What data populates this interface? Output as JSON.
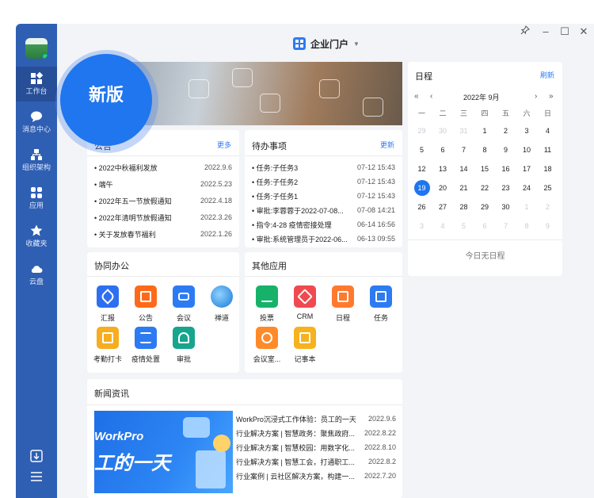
{
  "window": {
    "title": "企业门户",
    "controls": [
      "pin",
      "minimize",
      "maximize",
      "close"
    ]
  },
  "sidebar": {
    "items": [
      {
        "label": "工作台",
        "icon": "workbench-icon",
        "active": true
      },
      {
        "label": "消息中心",
        "icon": "message-icon"
      },
      {
        "label": "组织架构",
        "icon": "org-icon"
      },
      {
        "label": "应用",
        "icon": "apps-icon"
      },
      {
        "label": "收藏夹",
        "icon": "star-icon"
      },
      {
        "label": "云盘",
        "icon": "cloud-icon"
      }
    ],
    "bottom": [
      "download-icon",
      "menu-icon"
    ]
  },
  "badge": {
    "label": "新版"
  },
  "announcements": {
    "title": "公告",
    "more": "更多",
    "items": [
      {
        "title": "2022中秋福利发放",
        "date": "2022.9.6"
      },
      {
        "title": "端午",
        "date": "2022.5.23"
      },
      {
        "title": "2022年五一节放假通知",
        "date": "2022.4.18"
      },
      {
        "title": "2022年清明节放假通知",
        "date": "2022.3.26"
      },
      {
        "title": "关于发放春节福利",
        "date": "2022.1.26"
      }
    ]
  },
  "todos": {
    "title": "待办事项",
    "more": "更新",
    "items": [
      {
        "title": "任务:子任务3",
        "date": "07-12 15:43"
      },
      {
        "title": "任务:子任务2",
        "date": "07-12 15:43"
      },
      {
        "title": "任务:子任务1",
        "date": "07-12 15:43"
      },
      {
        "title": "审批:李蓉蓉于2022-07-08...",
        "date": "07-08 14:21"
      },
      {
        "title": "指令:4-28 疫情密接处理",
        "date": "06-14 16:56"
      },
      {
        "title": "审批:系统管理员于2022-06...",
        "date": "06-13 09:55"
      }
    ]
  },
  "collab": {
    "title": "协同办公",
    "apps": [
      {
        "label": "汇报",
        "color": "#2d6ff0"
      },
      {
        "label": "公告",
        "color": "#ff6a1a"
      },
      {
        "label": "会议",
        "color": "#2d7bf2"
      },
      {
        "label": "禅道",
        "color": "#2a9df4"
      },
      {
        "label": "考勤打卡",
        "color": "#f6ad1f"
      },
      {
        "label": "疫情处置",
        "color": "#2d7bf2"
      },
      {
        "label": "审批",
        "color": "#16a58d"
      }
    ]
  },
  "others": {
    "title": "其他应用",
    "apps": [
      {
        "label": "投票",
        "color": "#17b26a"
      },
      {
        "label": "CRM",
        "color": "#f0494f"
      },
      {
        "label": "日程",
        "color": "#ff7a2e"
      },
      {
        "label": "任务",
        "color": "#2d7bf2"
      },
      {
        "label": "会议室...",
        "color": "#ff8a2a"
      },
      {
        "label": "记事本",
        "color": "#f6b21f"
      }
    ]
  },
  "schedule": {
    "title": "日程",
    "refresh": "刷新",
    "month": "2022年 9月",
    "nav": {
      "prev_year": "«",
      "prev_month": "‹",
      "next_month": "›",
      "next_year": "»"
    },
    "weekdays": [
      "一",
      "二",
      "三",
      "四",
      "五",
      "六",
      "日"
    ],
    "weeks": [
      [
        "29",
        "30",
        "31",
        "1",
        "2",
        "3",
        "4"
      ],
      [
        "5",
        "6",
        "7",
        "8",
        "9",
        "10",
        "11"
      ],
      [
        "12",
        "13",
        "14",
        "15",
        "16",
        "17",
        "18"
      ],
      [
        "19",
        "20",
        "21",
        "22",
        "23",
        "24",
        "25"
      ],
      [
        "26",
        "27",
        "28",
        "29",
        "30",
        "1",
        "2"
      ],
      [
        "3",
        "4",
        "5",
        "6",
        "7",
        "8",
        "9"
      ]
    ],
    "today": "19",
    "empty": "今日无日程"
  },
  "news": {
    "title": "新闻资讯",
    "image_text": [
      "WorkPro",
      "工的一天"
    ],
    "items": [
      {
        "title": "WorkPro沉浸式工作体验：员工的一天",
        "date": "2022.9.6"
      },
      {
        "title": "行业解决方案 | 智慧政务：聚焦政府...",
        "date": "2022.8.22"
      },
      {
        "title": "行业解决方案 | 智慧校园：用数字化...",
        "date": "2022.8.10"
      },
      {
        "title": "行业解决方案 | 智慧工会，打通职工...",
        "date": "2022.8.2"
      },
      {
        "title": "行业案例 | 云社区解决方案，构建一...",
        "date": "2022.7.20"
      }
    ]
  }
}
